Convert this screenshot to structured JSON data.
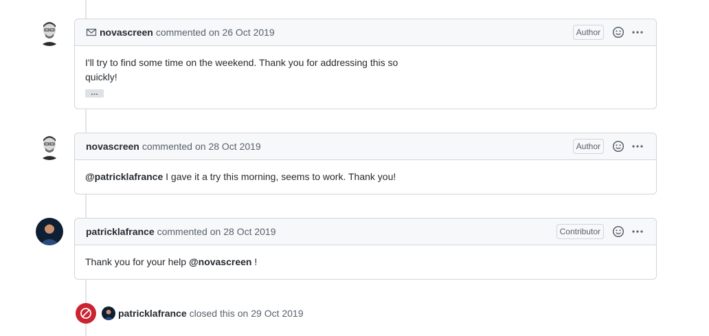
{
  "comments": [
    {
      "author": "novascreen",
      "action": "commented",
      "date": "on 26 Oct 2019",
      "badge": "Author",
      "show_mail_icon": true,
      "body_lines": [
        "I'll try to find some time on the weekend. Thank you for addressing this so",
        "quickly!"
      ],
      "hidden_text_label": "…"
    },
    {
      "author": "novascreen",
      "action": "commented",
      "date": "on 28 Oct 2019",
      "badge": "Author",
      "body_mention": "@patricklafrance",
      "body_text": " I gave it a try this morning, seems to work. Thank you!"
    },
    {
      "author": "patricklafrance",
      "action": "commented",
      "date": "on 28 Oct 2019",
      "badge": "Contributor",
      "body_text": "Thank you for your help ",
      "body_mention": "@novascreen",
      "body_suffix": " !"
    }
  ],
  "event": {
    "author": "patricklafrance",
    "action": "closed this",
    "date": "on 29 Oct 2019"
  },
  "colors": {
    "closed_red": "#cb2431",
    "header_bg": "#f6f8fa",
    "border": "#d1d5da"
  },
  "icons": {
    "mail": "mail-icon",
    "smiley": "smiley-icon",
    "kebab": "kebab-horizontal-icon",
    "closed": "circle-slash-icon"
  }
}
